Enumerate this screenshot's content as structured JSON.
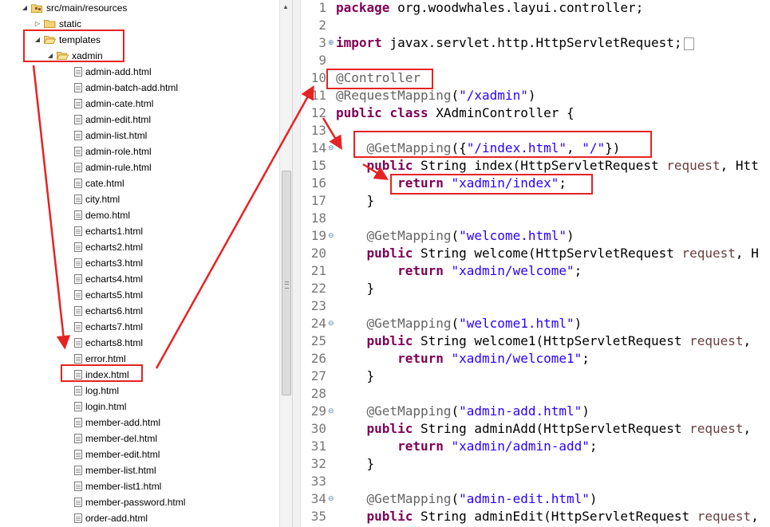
{
  "tree": {
    "items": [
      {
        "label": "src/main/resources",
        "kind": "package",
        "arrow": "down"
      },
      {
        "label": "static",
        "kind": "folder",
        "arrow": "right"
      },
      {
        "label": "templates",
        "kind": "folder",
        "arrow": "down"
      },
      {
        "label": "xadmin",
        "kind": "folder",
        "arrow": "down"
      },
      {
        "label": "admin-add.html",
        "kind": "file"
      },
      {
        "label": "admin-batch-add.html",
        "kind": "file"
      },
      {
        "label": "admin-cate.html",
        "kind": "file"
      },
      {
        "label": "admin-edit.html",
        "kind": "file"
      },
      {
        "label": "admin-list.html",
        "kind": "file"
      },
      {
        "label": "admin-role.html",
        "kind": "file"
      },
      {
        "label": "admin-rule.html",
        "kind": "file"
      },
      {
        "label": "cate.html",
        "kind": "file"
      },
      {
        "label": "city.html",
        "kind": "file"
      },
      {
        "label": "demo.html",
        "kind": "file"
      },
      {
        "label": "echarts1.html",
        "kind": "file"
      },
      {
        "label": "echarts2.html",
        "kind": "file"
      },
      {
        "label": "echarts3.html",
        "kind": "file"
      },
      {
        "label": "echarts4.html",
        "kind": "file"
      },
      {
        "label": "echarts5.html",
        "kind": "file"
      },
      {
        "label": "echarts6.html",
        "kind": "file"
      },
      {
        "label": "echarts7.html",
        "kind": "file"
      },
      {
        "label": "echarts8.html",
        "kind": "file"
      },
      {
        "label": "error.html",
        "kind": "file"
      },
      {
        "label": "index.html",
        "kind": "file"
      },
      {
        "label": "log.html",
        "kind": "file"
      },
      {
        "label": "login.html",
        "kind": "file"
      },
      {
        "label": "member-add.html",
        "kind": "file"
      },
      {
        "label": "member-del.html",
        "kind": "file"
      },
      {
        "label": "member-edit.html",
        "kind": "file"
      },
      {
        "label": "member-list.html",
        "kind": "file"
      },
      {
        "label": "member-list1.html",
        "kind": "file"
      },
      {
        "label": "member-password.html",
        "kind": "file"
      },
      {
        "label": "order-add.html",
        "kind": "file"
      }
    ]
  },
  "editor": {
    "lines": [
      {
        "n": "1",
        "fold": "",
        "tokens": [
          [
            "kw",
            "package"
          ],
          [
            "pl",
            " org.woodwhales.layui.controller;"
          ]
        ]
      },
      {
        "n": "2",
        "fold": "",
        "tokens": []
      },
      {
        "n": "3",
        "fold": "plus",
        "tokens": [
          [
            "kw",
            "import"
          ],
          [
            "pl",
            " javax.servlet.http.HttpServletRequest;"
          ]
        ],
        "collapsed": true
      },
      {
        "n": "9",
        "fold": "",
        "tokens": []
      },
      {
        "n": "10",
        "fold": "",
        "tokens": [
          [
            "ann",
            "@Controller"
          ]
        ]
      },
      {
        "n": "11",
        "fold": "",
        "tokens": [
          [
            "ann",
            "@RequestMapping"
          ],
          [
            "pl",
            "("
          ],
          [
            "str",
            "\"/xadmin\""
          ],
          [
            "pl",
            ")"
          ]
        ]
      },
      {
        "n": "12",
        "fold": "",
        "tokens": [
          [
            "kw",
            "public"
          ],
          [
            "pl",
            " "
          ],
          [
            "kw",
            "class"
          ],
          [
            "pl",
            " XAdminController {"
          ]
        ]
      },
      {
        "n": "13",
        "fold": "",
        "tokens": []
      },
      {
        "n": "14",
        "fold": "minus",
        "tokens": [
          [
            "pl",
            "    "
          ],
          [
            "ann",
            "@GetMapping"
          ],
          [
            "pl",
            "({"
          ],
          [
            "str",
            "\"/index.html\""
          ],
          [
            "pl",
            ", "
          ],
          [
            "str",
            "\"/\""
          ],
          [
            "pl",
            "})"
          ]
        ]
      },
      {
        "n": "15",
        "fold": "",
        "tokens": [
          [
            "pl",
            "    "
          ],
          [
            "kw",
            "public"
          ],
          [
            "pl",
            " String index(HttpServletRequest "
          ],
          [
            "prm",
            "request"
          ],
          [
            "pl",
            ", Htt"
          ]
        ]
      },
      {
        "n": "16",
        "fold": "",
        "tokens": [
          [
            "pl",
            "        "
          ],
          [
            "kw",
            "return"
          ],
          [
            "pl",
            " "
          ],
          [
            "str",
            "\"xadmin/index\""
          ],
          [
            "pl",
            ";"
          ]
        ]
      },
      {
        "n": "17",
        "fold": "",
        "tokens": [
          [
            "pl",
            "    }"
          ]
        ]
      },
      {
        "n": "18",
        "fold": "",
        "tokens": []
      },
      {
        "n": "19",
        "fold": "minus",
        "tokens": [
          [
            "pl",
            "    "
          ],
          [
            "ann",
            "@GetMapping"
          ],
          [
            "pl",
            "("
          ],
          [
            "str",
            "\"welcome.html\""
          ],
          [
            "pl",
            ")"
          ]
        ]
      },
      {
        "n": "20",
        "fold": "",
        "tokens": [
          [
            "pl",
            "    "
          ],
          [
            "kw",
            "public"
          ],
          [
            "pl",
            " String welcome(HttpServletRequest "
          ],
          [
            "prm",
            "request"
          ],
          [
            "pl",
            ", H"
          ]
        ]
      },
      {
        "n": "21",
        "fold": "",
        "tokens": [
          [
            "pl",
            "        "
          ],
          [
            "kw",
            "return"
          ],
          [
            "pl",
            " "
          ],
          [
            "str",
            "\"xadmin/welcome\""
          ],
          [
            "pl",
            ";"
          ]
        ]
      },
      {
        "n": "22",
        "fold": "",
        "tokens": [
          [
            "pl",
            "    }"
          ]
        ]
      },
      {
        "n": "23",
        "fold": "",
        "tokens": []
      },
      {
        "n": "24",
        "fold": "minus",
        "tokens": [
          [
            "pl",
            "    "
          ],
          [
            "ann",
            "@GetMapping"
          ],
          [
            "pl",
            "("
          ],
          [
            "str",
            "\"welcome1.html\""
          ],
          [
            "pl",
            ")"
          ]
        ]
      },
      {
        "n": "25",
        "fold": "",
        "tokens": [
          [
            "pl",
            "    "
          ],
          [
            "kw",
            "public"
          ],
          [
            "pl",
            " String welcome1(HttpServletRequest "
          ],
          [
            "prm",
            "request"
          ],
          [
            "pl",
            ","
          ]
        ]
      },
      {
        "n": "26",
        "fold": "",
        "tokens": [
          [
            "pl",
            "        "
          ],
          [
            "kw",
            "return"
          ],
          [
            "pl",
            " "
          ],
          [
            "str",
            "\"xadmin/welcome1\""
          ],
          [
            "pl",
            ";"
          ]
        ]
      },
      {
        "n": "27",
        "fold": "",
        "tokens": [
          [
            "pl",
            "    }"
          ]
        ]
      },
      {
        "n": "28",
        "fold": "",
        "tokens": []
      },
      {
        "n": "29",
        "fold": "minus",
        "tokens": [
          [
            "pl",
            "    "
          ],
          [
            "ann",
            "@GetMapping"
          ],
          [
            "pl",
            "("
          ],
          [
            "str",
            "\"admin-add.html\""
          ],
          [
            "pl",
            ")"
          ]
        ]
      },
      {
        "n": "30",
        "fold": "",
        "tokens": [
          [
            "pl",
            "    "
          ],
          [
            "kw",
            "public"
          ],
          [
            "pl",
            " String adminAdd(HttpServletRequest "
          ],
          [
            "prm",
            "request"
          ],
          [
            "pl",
            ","
          ]
        ]
      },
      {
        "n": "31",
        "fold": "",
        "tokens": [
          [
            "pl",
            "        "
          ],
          [
            "kw",
            "return"
          ],
          [
            "pl",
            " "
          ],
          [
            "str",
            "\"xadmin/admin-add\""
          ],
          [
            "pl",
            ";"
          ]
        ]
      },
      {
        "n": "32",
        "fold": "",
        "tokens": [
          [
            "pl",
            "    }"
          ]
        ]
      },
      {
        "n": "33",
        "fold": "",
        "tokens": []
      },
      {
        "n": "34",
        "fold": "minus",
        "tokens": [
          [
            "pl",
            "    "
          ],
          [
            "ann",
            "@GetMapping"
          ],
          [
            "pl",
            "("
          ],
          [
            "str",
            "\"admin-edit.html\""
          ],
          [
            "pl",
            ")"
          ]
        ]
      },
      {
        "n": "35",
        "fold": "",
        "tokens": [
          [
            "pl",
            "    "
          ],
          [
            "kw",
            "public"
          ],
          [
            "pl",
            " String adminEdit(HttpServletRequest "
          ],
          [
            "prm",
            "request"
          ],
          [
            "pl",
            ","
          ]
        ]
      }
    ]
  },
  "colors": {
    "highlight": "#e52323",
    "keyword": "#7f0055",
    "annotation": "#646464",
    "string": "#2a00ff",
    "parameter": "#6a3e3e"
  }
}
